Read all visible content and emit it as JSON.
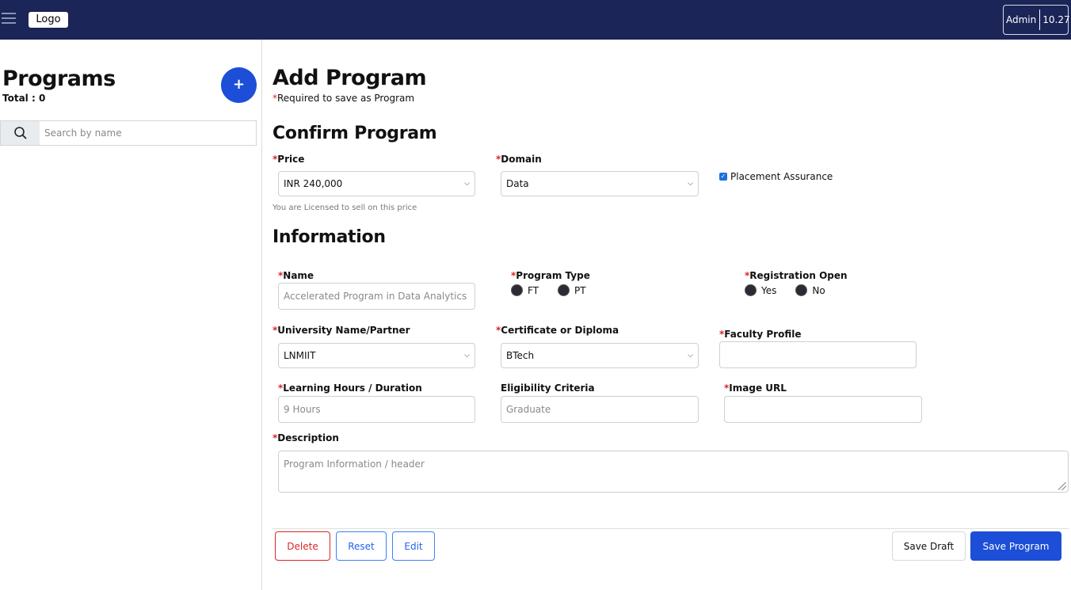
{
  "topbar": {
    "logo": "Logo",
    "user": "Admin",
    "version": "10.27"
  },
  "sidebar": {
    "title": "Programs",
    "total": "Total : 0",
    "add_label": "+",
    "search_placeholder": "Search by name"
  },
  "form": {
    "title": "Add Program",
    "required_note": "Required to save as Program",
    "required_mark": "*",
    "confirm_heading": "Confirm Program",
    "price_label": "Price",
    "price_value": "INR 240,000",
    "price_hint": "You are Licensed to sell on this price",
    "domain_label": "Domain",
    "domain_value": "Data",
    "placement_label": "Placement Assurance",
    "placement_checked": true,
    "info_heading": "Information",
    "name_label": "Name",
    "name_placeholder": "Accelerated Program in Data Analytics",
    "program_type_label": "Program Type",
    "program_type_options": [
      "FT",
      "PT"
    ],
    "registration_label": "Registration Open",
    "registration_options": [
      "Yes",
      "No"
    ],
    "university_label": "University Name/Partner",
    "university_value": "LNMIIT",
    "certificate_label": "Certificate or Diploma",
    "certificate_value": "BTech",
    "faculty_label": "Faculty Profile",
    "hours_label": "Learning Hours / Duration",
    "hours_placeholder": "9 Hours",
    "eligibility_label": "Eligibility Criteria",
    "eligibility_placeholder": "Graduate",
    "image_label": "Image URL",
    "description_label": "Description",
    "description_placeholder": "Program Information / header"
  },
  "actions": {
    "delete": "Delete",
    "reset": "Reset",
    "edit": "Edit",
    "save_draft": "Save Draft",
    "save_program": "Save Program"
  },
  "colors": {
    "topbar": "#1b2557",
    "primary": "#1d4ed8",
    "danger": "#dc2626"
  },
  "icons": {
    "menu": "hamburger-icon",
    "search": "search-icon",
    "add": "plus-icon",
    "chevron": "chevron-down-icon"
  }
}
